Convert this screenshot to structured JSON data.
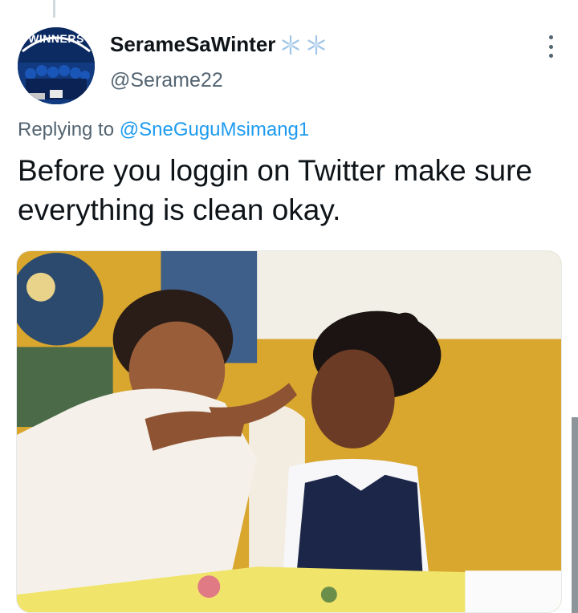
{
  "tweet": {
    "display_name": "SerameSaWinter",
    "name_emoji": [
      "snowflake-icon",
      "snowflake-icon"
    ],
    "handle": "@Serame22",
    "avatar_text": "WINNERS",
    "replying_prefix": "Replying to ",
    "replying_to": "@SneGuguMsimang1",
    "text": "Before you loggin on Twitter make sure everything is clean okay.",
    "media_description_icon": "photo"
  },
  "colors": {
    "mention": "#1d9bf0",
    "secondary_text": "#536471",
    "primary_text": "#0f1419",
    "snowflake": "#9fc5e8"
  }
}
